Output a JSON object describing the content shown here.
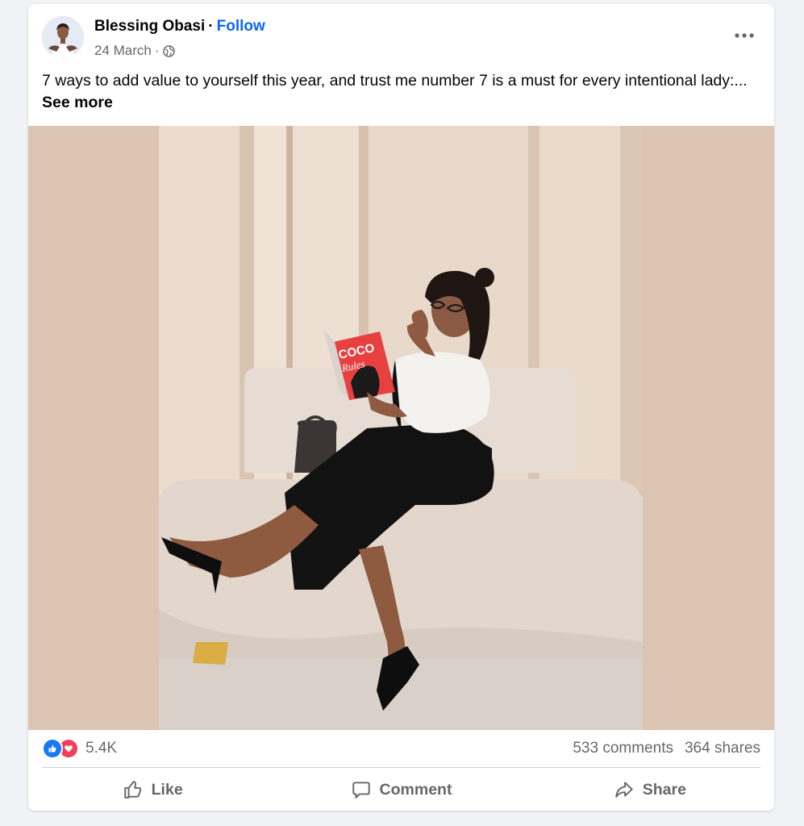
{
  "post": {
    "author": "Blessing Obasi",
    "separator": "·",
    "follow_label": "Follow",
    "date": "24 March",
    "date_separator": "·",
    "caption": "7 ways to add value to yourself this year, and trust me number 7 is a must for every intentional lady:...",
    "see_more": "See more",
    "image": {
      "book_title_line1": "COCO",
      "book_title_line2": "Rules"
    }
  },
  "stats": {
    "reactions_count": "5.4K",
    "comments": "533 comments",
    "shares": "364 shares"
  },
  "actions": {
    "like": "Like",
    "comment": "Comment",
    "share": "Share"
  },
  "icons": {
    "avatar": "avatar-photo",
    "privacy": "globe-icon",
    "more": "more-options-icon",
    "reaction_like": "like-reaction-icon",
    "reaction_love": "love-reaction-icon",
    "like": "thumbs-up-icon",
    "comment": "comment-bubble-icon",
    "share": "share-arrow-icon"
  },
  "colors": {
    "link": "#0866ff",
    "secondary_text": "#65676b",
    "like": "#1877f2",
    "love": "#f33e58",
    "photo_background": "#dcc4b3"
  }
}
